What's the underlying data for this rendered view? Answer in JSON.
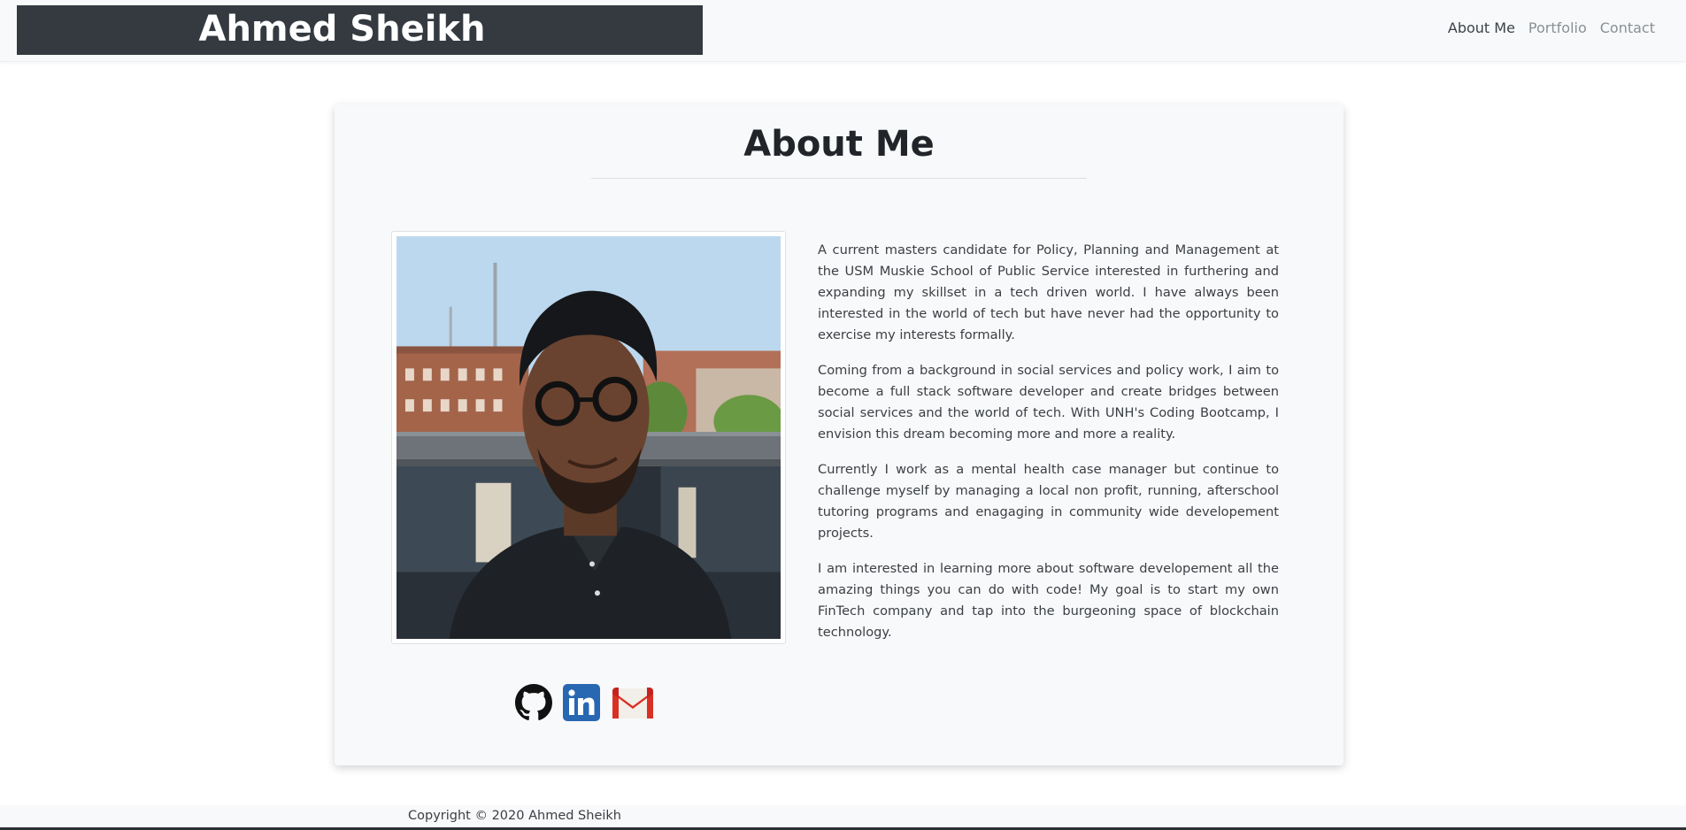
{
  "navbar": {
    "brand": "Ahmed Sheikh",
    "links": [
      {
        "label": "About Me",
        "active": true
      },
      {
        "label": "Portfolio",
        "active": false
      },
      {
        "label": "Contact",
        "active": false
      }
    ]
  },
  "about": {
    "title": "About Me",
    "paragraphs": [
      "A current masters candidate for Policy, Planning and Management at the USM Muskie School of Public Service interested in furthering and expanding my skillset in a tech driven world. I have always been interested in the world of tech but have never had the opportunity to exercise my interests formally.",
      "Coming from a background in social services and policy work, I aim to become a full stack software developer and create bridges between social services and the world of tech. With UNH's Coding Bootcamp, I envision this dream becoming more and more a reality.",
      "Currently I work as a mental health case manager but continue to challenge myself by managing a local non profit, running, afterschool tutoring programs and enagaging in community wide developement projects.",
      "I am interested in learning more about software developement all the amazing things you can do with code! My goal is to start my own FinTech company and tap into the burgeoning space of blockchain technology."
    ]
  },
  "socials": [
    {
      "icon": "github-icon"
    },
    {
      "icon": "linkedin-icon"
    },
    {
      "icon": "gmail-icon"
    }
  ],
  "footer": {
    "text": "Copyright © 2020 Ahmed Sheikh"
  },
  "colors": {
    "navbar_bg": "#f8f9fa",
    "brand_bg": "#343a40",
    "card_bg": "#f8f9fa",
    "linkedin_blue": "#2867b2",
    "gmail_red": "#d93025"
  }
}
